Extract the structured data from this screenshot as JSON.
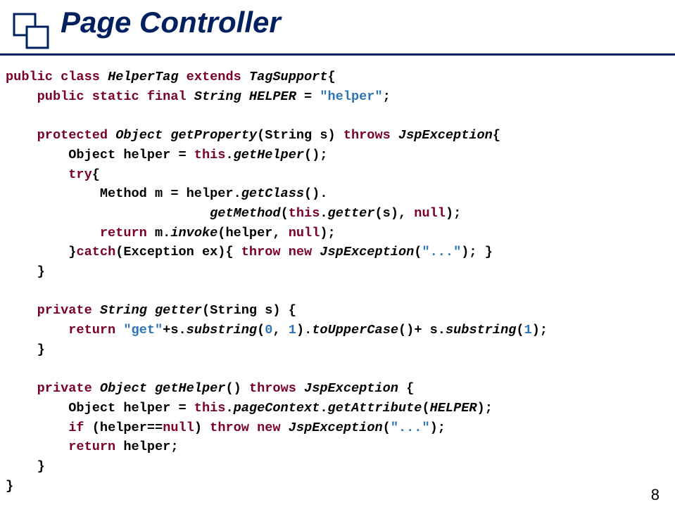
{
  "title": "Page Controller",
  "pagenum": "8",
  "code": {
    "l1a": "public class ",
    "l1b": "HelperTag ",
    "l1c": "extends ",
    "l1d": "TagSupport",
    "l1e": "{",
    "l2a": "    public static final ",
    "l2b": "String ",
    "l2c": "HELPER",
    "l2d": " = ",
    "l2e": "\"helper\"",
    "l2f": ";",
    "l3": "",
    "l4a": "    protected ",
    "l4b": "Object ",
    "l4c": "getProperty",
    "l4d": "(String s) ",
    "l4e": "throws ",
    "l4f": "JspException",
    "l4g": "{",
    "l5a": "        Object helper = ",
    "l5b": "this",
    "l5c": ".",
    "l5d": "getHelper",
    "l5e": "();",
    "l6a": "        try",
    "l6b": "{",
    "l7a": "            Method m = helper.",
    "l7b": "getClass",
    "l7c": "().",
    "l8a": "                          ",
    "l8b": "getMethod",
    "l8c": "(",
    "l8d": "this",
    "l8e": ".",
    "l8f": "getter",
    "l8g": "(s), ",
    "l8h": "null",
    "l8i": ");",
    "l9a": "            return ",
    "l9b": "m.",
    "l9c": "invoke",
    "l9d": "(helper, ",
    "l9e": "null",
    "l9f": ");",
    "l10a": "        }",
    "l10b": "catch",
    "l10c": "(Exception ex){ ",
    "l10d": "throw new ",
    "l10e": "JspException",
    "l10f": "(",
    "l10g": "\"...\"",
    "l10h": "); }",
    "l11": "    }",
    "l12": "",
    "l13a": "    private ",
    "l13b": "String ",
    "l13c": "getter",
    "l13d": "(String s) {",
    "l14a": "        return ",
    "l14b": "\"get\"",
    "l14c": "+s.",
    "l14d": "substring",
    "l14e": "(",
    "l14f": "0",
    "l14g": ", ",
    "l14h": "1",
    "l14i": ").",
    "l14j": "toUpperCase",
    "l14k": "()+ s.",
    "l14l": "substring",
    "l14m": "(",
    "l14n": "1",
    "l14o": ");",
    "l15": "    }",
    "l16": "",
    "l17a": "    private ",
    "l17b": "Object ",
    "l17c": "getHelper",
    "l17d": "() ",
    "l17e": "throws ",
    "l17f": "JspException ",
    "l17g": "{",
    "l18a": "        Object helper = ",
    "l18b": "this",
    "l18c": ".",
    "l18d": "pageContext",
    "l18e": ".",
    "l18f": "getAttribute",
    "l18g": "(",
    "l18h": "HELPER",
    "l18i": ");",
    "l19a": "        if ",
    "l19b": "(helper==",
    "l19c": "null",
    "l19d": ") ",
    "l19e": "throw new ",
    "l19f": "JspException",
    "l19g": "(",
    "l19h": "\"...\"",
    "l19i": ");",
    "l20a": "        return ",
    "l20b": "helper;",
    "l21": "    }",
    "l22": "}"
  }
}
